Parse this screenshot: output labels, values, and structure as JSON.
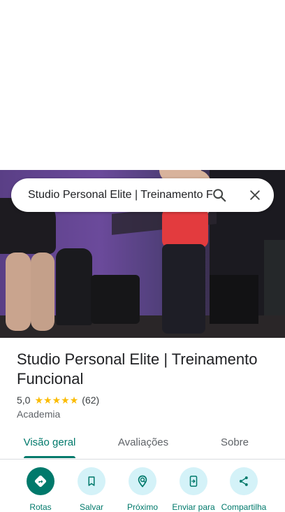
{
  "search": {
    "query": "Studio Personal Elite | Treinamento F",
    "search_icon": "search-icon",
    "close_icon": "close-icon"
  },
  "place": {
    "title": "Studio Personal Elite | Treinamento Funcional",
    "rating": "5,0",
    "stars": 5,
    "review_count": "(62)",
    "category": "Academia"
  },
  "tabs": [
    {
      "label": "Visão geral",
      "active": true
    },
    {
      "label": "Avaliações",
      "active": false
    },
    {
      "label": "Sobre",
      "active": false
    }
  ],
  "actions": [
    {
      "label": "Rotas",
      "icon": "directions-icon"
    },
    {
      "label": "Salvar",
      "icon": "bookmark-icon"
    },
    {
      "label": "Próximo",
      "icon": "nearby-icon"
    },
    {
      "label": "Enviar para",
      "icon": "send-to-phone-icon"
    },
    {
      "label": "Compartilha",
      "icon": "share-icon"
    }
  ],
  "colors": {
    "accent": "#00796b",
    "action_bg": "#d4f2f8",
    "star": "#fbbc04"
  }
}
